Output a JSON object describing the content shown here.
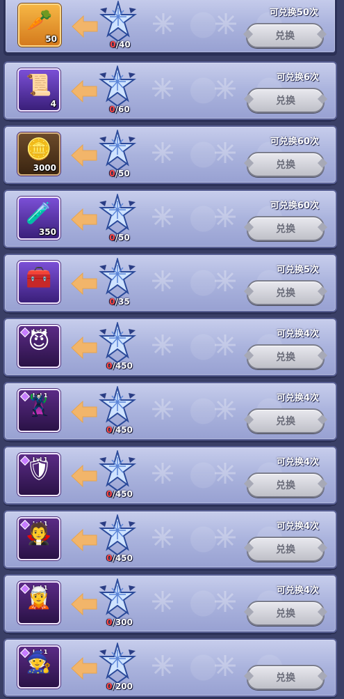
{
  "colors": {
    "row_bg": "#aab3dd",
    "progress_zero": "#ff4848",
    "button_bg": "#d8d9e0"
  },
  "rows": [
    {
      "icon": "carrot-bag-icon",
      "glyph": "🥕",
      "qty": "50",
      "lvl": "",
      "progress_done": "0",
      "progress_total": "/40",
      "limit": "可兑换50次",
      "button": "兑换",
      "style": "gold"
    },
    {
      "icon": "scroll-icon",
      "glyph": "📜",
      "qty": "4",
      "lvl": "",
      "progress_done": "0",
      "progress_total": "/60",
      "limit": "可兑换6次",
      "button": "兑换",
      "style": "purple"
    },
    {
      "icon": "coin-icon",
      "glyph": "🪙",
      "qty": "3000",
      "lvl": "",
      "progress_done": "0",
      "progress_total": "/50",
      "limit": "可兑换60次",
      "button": "兑换",
      "style": "brown"
    },
    {
      "icon": "potion-icon",
      "glyph": "🧪",
      "qty": "350",
      "lvl": "",
      "progress_done": "0",
      "progress_total": "/50",
      "limit": "可兑换60次",
      "button": "兑换",
      "style": "purple"
    },
    {
      "icon": "chest-icon",
      "glyph": "🧰",
      "qty": "",
      "lvl": "",
      "progress_done": "0",
      "progress_total": "/35",
      "limit": "可兑换5次",
      "button": "兑换",
      "style": "purple"
    },
    {
      "icon": "hero-portrait-icon",
      "glyph": "😈",
      "qty": "",
      "lvl": "Lvl 1",
      "progress_done": "0",
      "progress_total": "/450",
      "limit": "可兑换4次",
      "button": "兑换",
      "style": "hero"
    },
    {
      "icon": "hero-portrait-icon",
      "glyph": "🦹",
      "qty": "",
      "lvl": "Lvl 1",
      "progress_done": "0",
      "progress_total": "/450",
      "limit": "可兑换4次",
      "button": "兑换",
      "style": "hero"
    },
    {
      "icon": "hero-portrait-icon",
      "glyph": "🛡",
      "qty": "",
      "lvl": "Lvl 1",
      "progress_done": "0",
      "progress_total": "/450",
      "limit": "可兑换4次",
      "button": "兑换",
      "style": "hero"
    },
    {
      "icon": "hero-portrait-icon",
      "glyph": "🧛",
      "qty": "",
      "lvl": "Lvl 1",
      "progress_done": "0",
      "progress_total": "/450",
      "limit": "可兑换4次",
      "button": "兑换",
      "style": "hero"
    },
    {
      "icon": "hero-portrait-icon",
      "glyph": "🧝",
      "qty": "",
      "lvl": "Lvl 1",
      "progress_done": "0",
      "progress_total": "/300",
      "limit": "可兑换4次",
      "button": "兑换",
      "style": "hero"
    },
    {
      "icon": "hero-portrait-icon",
      "glyph": "🧙",
      "qty": "",
      "lvl": "Lvl 1",
      "progress_done": "0",
      "progress_total": "/200",
      "limit": "",
      "button": "兑换",
      "style": "hero"
    }
  ]
}
